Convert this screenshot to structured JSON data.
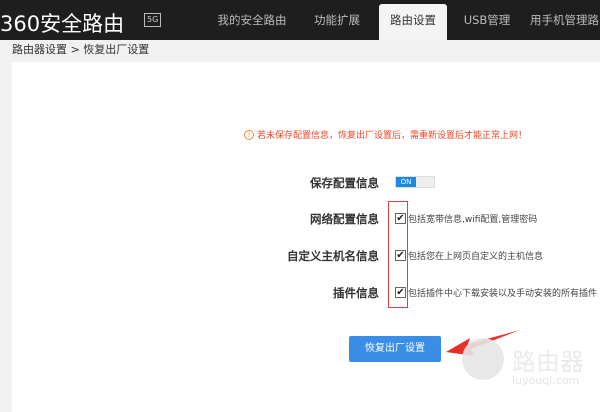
{
  "header": {
    "logo": "360安全路由",
    "badge": "5G",
    "tabs": [
      "我的安全路由",
      "功能扩展",
      "路由设置",
      "USB管理",
      "用手机管理路由"
    ],
    "active_tab": 2
  },
  "breadcrumb": "路由器设置 > 恢复出厂设置",
  "warning": "若未保存配置信息，恢复出厂设置后，需重新设置后才能正常上网！",
  "save_config": {
    "label": "保存配置信息",
    "toggle": "ON"
  },
  "options": [
    {
      "label": "网络配置信息",
      "desc": "包括宽带信息,wifi配置,管理密码",
      "checked": true
    },
    {
      "label": "自定义主机名信息",
      "desc": "包括您在上网页自定义的主机信息",
      "checked": true
    },
    {
      "label": "插件信息",
      "desc": "包括插件中心下载安装以及手动安装的所有插件",
      "checked": true
    }
  ],
  "reset_button": "恢复出厂设置",
  "watermark": {
    "title": "路由器",
    "url": "luyouqi.com"
  },
  "colors": {
    "accent": "#3a8ee6",
    "warning": "#f0462a",
    "annotation": "#e04040"
  }
}
